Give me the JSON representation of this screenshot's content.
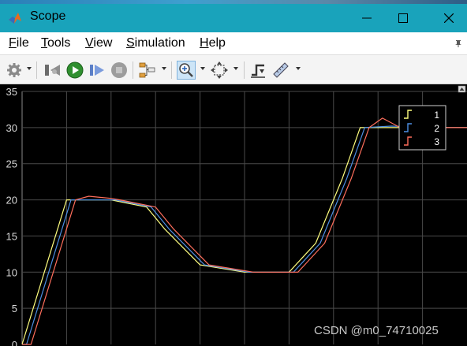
{
  "window": {
    "title": "Scope",
    "app_icon": "matlab-logo-icon",
    "controls": [
      "minimize-icon",
      "maximize-icon",
      "close-icon"
    ],
    "titlebar_color": "#19a3bb"
  },
  "menu": {
    "items": [
      {
        "mnemonic": "F",
        "rest": "ile"
      },
      {
        "mnemonic": "T",
        "rest": "ools"
      },
      {
        "mnemonic": "V",
        "rest": "iew"
      },
      {
        "mnemonic": "S",
        "rest": "imulation"
      },
      {
        "mnemonic": "H",
        "rest": "elp"
      }
    ]
  },
  "toolbar": {
    "buttons": [
      "settings-icon",
      "step-back-icon",
      "run-icon",
      "step-forward-icon",
      "stop-icon",
      "signal-routing-icon",
      "zoom-icon",
      "autoscale-icon",
      "triggers-icon",
      "measurements-icon"
    ],
    "active": "zoom-icon"
  },
  "chart_data": {
    "type": "line",
    "ylim": [
      0,
      35
    ],
    "yticks": [
      "35",
      "30",
      "25",
      "20",
      "15",
      "10",
      "5",
      "0"
    ],
    "grid": true,
    "legend_position": "top-right",
    "series": [
      {
        "name": "1",
        "color": "#ffff7f",
        "x": [
          0,
          1.0,
          1.5,
          2.0,
          2.8,
          3.2,
          4.0,
          5.0,
          6.0,
          6.6,
          7.2,
          7.6,
          8.2,
          9.2,
          10.0
        ],
        "y": [
          0,
          20.0,
          20.0,
          20.0,
          19.0,
          16.0,
          11.0,
          10.0,
          10.0,
          14.0,
          23.0,
          30.0,
          30.0,
          30.0,
          30.0
        ]
      },
      {
        "name": "2",
        "color": "#4d8fe3",
        "x": [
          0,
          0.1,
          1.1,
          1.6,
          2.1,
          2.9,
          3.3,
          4.1,
          5.1,
          6.1,
          6.7,
          7.3,
          7.7,
          8.3,
          9.3,
          10.0
        ],
        "y": [
          0,
          0,
          20.0,
          20.0,
          20.0,
          19.0,
          16.0,
          11.0,
          10.0,
          10.0,
          14.0,
          23.0,
          30.0,
          30.2,
          30.0,
          30.0
        ]
      },
      {
        "name": "3",
        "color": "#ff6e5c",
        "x": [
          0,
          0.2,
          1.2,
          1.5,
          2.0,
          2.2,
          3.0,
          3.4,
          4.2,
          5.2,
          6.2,
          6.8,
          7.4,
          7.8,
          8.1,
          8.5,
          9.4,
          10.0
        ],
        "y": [
          0,
          0,
          20.0,
          20.5,
          20.2,
          20.0,
          19.0,
          16.0,
          11.0,
          10.0,
          10.0,
          14.0,
          23.0,
          30.0,
          31.3,
          30.0,
          30.0,
          30.0
        ]
      }
    ]
  },
  "watermark": "CSDN @m0_74710025"
}
